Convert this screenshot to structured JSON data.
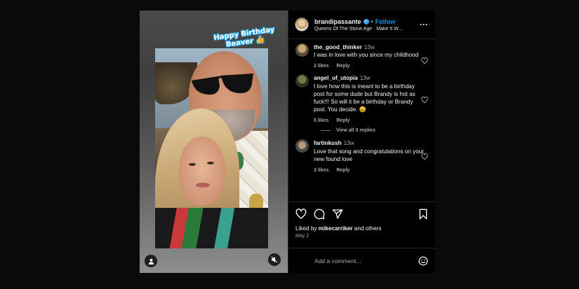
{
  "media": {
    "sticker_line1": "Happy Birthday",
    "sticker_line2": "Beaver 👍",
    "user_icon": "user-icon",
    "mute_icon": "mute-icon"
  },
  "post": {
    "username": "brandipassante",
    "separator": "•",
    "follow_label": "Follow",
    "audio": "Queens Of The Stone Age · Make It W...",
    "more_icon": "more-options-icon"
  },
  "comments": [
    {
      "user": "the_good_thinker",
      "time": "13w",
      "text": "I was in love with you since my childhood",
      "likes": "2 likes",
      "reply": "Reply"
    },
    {
      "user": "angel_of_utopia",
      "time": "13w",
      "text": "I love how this is meant to be a birthday post for some dude but Brandy is hot as fuck!!! So will it be a birthday or Brandy post. You decide. 😄",
      "likes": "5 likes",
      "reply": "Reply"
    },
    {
      "user": "fartinkush",
      "time": "13w",
      "text": "Love that song and congratulations on your new found love",
      "likes": "3 likes",
      "reply": "Reply"
    }
  ],
  "view_replies": "View all 3 replies",
  "likes": {
    "prefix": "Liked by ",
    "user": "mikecarriker",
    "suffix": " and others"
  },
  "date": "May 2",
  "add_comment_placeholder": "Add a comment...",
  "colors": {
    "follow": "#0095f6",
    "background": "#000000",
    "muted_text": "#a8a8a8"
  }
}
